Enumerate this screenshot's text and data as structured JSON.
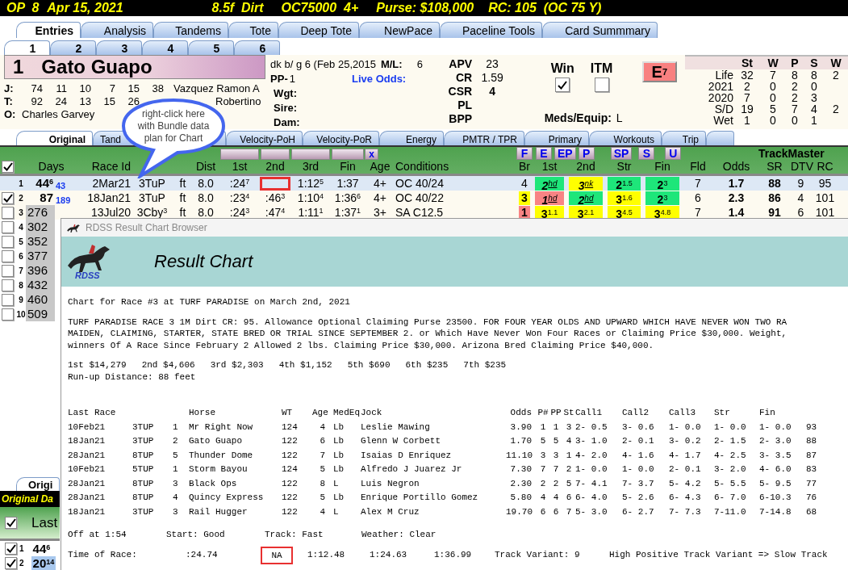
{
  "header": {
    "items": [
      "OP  8",
      "Apr 15, 2021",
      "8.5f  Dirt",
      "OC75000  4+",
      "Purse: $108,000",
      "RC: 105  (OC 75 Y)"
    ]
  },
  "main_tabs": [
    {
      "label": "Entries",
      "selected": true
    },
    {
      "label": "Analysis",
      "selected": false
    },
    {
      "label": "Tandems",
      "selected": false
    },
    {
      "label": "Tote",
      "selected": false
    },
    {
      "label": "Deep Tote",
      "selected": false
    },
    {
      "label": "NewPace",
      "selected": false
    },
    {
      "label": "Paceline Tools",
      "selected": false
    },
    {
      "label": "Card Summmary",
      "selected": false
    }
  ],
  "horse_tabs": [
    {
      "label": "1",
      "selected": true
    },
    {
      "label": "2",
      "selected": false
    },
    {
      "label": "3",
      "selected": false
    },
    {
      "label": "4",
      "selected": false
    },
    {
      "label": "5",
      "selected": false
    },
    {
      "label": "6",
      "selected": false
    }
  ],
  "horse": {
    "number": "1",
    "name": "Gato Guapo",
    "people": [
      {
        "label": "J:",
        "stats": [
          "74",
          "11",
          "10",
          "7",
          "15",
          "38"
        ],
        "name": "Vazquez Ramon A"
      },
      {
        "label": "T:",
        "stats": [
          "92",
          "24",
          "13",
          "15",
          "26"
        ],
        "name": "Robertino"
      },
      {
        "label": "O:",
        "name": "Charles Garvey"
      }
    ],
    "description": "dk b/ g 6 (Feb 25,2015",
    "ml_label": "M/L:",
    "ml": "6",
    "pp_label": "PP-",
    "pp": "1",
    "live_odds": "Live Odds:",
    "fields": [
      "Wgt:",
      "Sire:",
      "Dam:"
    ],
    "ratings": [
      {
        "label": "APV",
        "value": "23",
        "bold": false
      },
      {
        "label": "CR",
        "value": "1.59",
        "bold": false
      },
      {
        "label": "CSR",
        "value": "4",
        "bold": true
      },
      {
        "label": "PL"
      },
      {
        "label": "BPP"
      }
    ],
    "bets": [
      {
        "label": "Win",
        "checked": true
      },
      {
        "label": "ITM",
        "checked": false
      }
    ],
    "meds_label": "Meds/Equip:",
    "meds": "L",
    "badge": {
      "letter": "E",
      "sup": "7"
    },
    "record": {
      "columns": [
        "St",
        "W",
        "P",
        "S",
        "W"
      ],
      "rows": [
        {
          "label": "Life",
          "values": [
            "32",
            "7",
            "8",
            "8",
            "2"
          ]
        },
        {
          "label": "2021",
          "values": [
            "2",
            "0",
            "2",
            "0"
          ]
        },
        {
          "label": "2020",
          "values": [
            "7",
            "0",
            "2",
            "3"
          ]
        },
        {
          "label": "S/D",
          "values": [
            "19",
            "5",
            "7",
            "4",
            "2"
          ]
        },
        {
          "label": "Wet",
          "values": [
            "1",
            "0",
            "0",
            "1"
          ]
        }
      ]
    }
  },
  "sub_tabs": [
    {
      "label": "Original",
      "selected": true
    },
    {
      "label": "Tand",
      "selected": false
    },
    {
      "label": "Velocity-PoH",
      "selected": false
    },
    {
      "label": "Velocity-PoR",
      "selected": false
    },
    {
      "label": "Energy",
      "selected": false
    },
    {
      "label": "PMTR / TPR",
      "selected": false
    },
    {
      "label": "Primary",
      "selected": false
    },
    {
      "label": "Workouts",
      "selected": false
    },
    {
      "label": "Trip",
      "selected": false
    }
  ],
  "callout": {
    "text": "right-click here\nwith Bundle data\nplan for Chart"
  },
  "grid": {
    "header_checked": true,
    "close_button": "x",
    "pace_buttons": [
      "F",
      "E",
      "EP",
      "P",
      "SP",
      "S",
      "U"
    ],
    "group_label": "TrackMaster",
    "columns": [
      "Days",
      "Race Id",
      "Dist",
      "1st",
      "2nd",
      "3rd",
      "Fin",
      "Age",
      "Conditions",
      "Br",
      "1st",
      "2nd",
      "Str",
      "Fin",
      "Fld",
      "Odds",
      "SR",
      "DTV",
      "RC"
    ],
    "rows": [
      {
        "num": "1",
        "selected": true,
        "shaded": false,
        "days": "44",
        "days_sup": "6",
        "days_link": "43",
        "date": "2Mar21",
        "track": "3TuP",
        "surface": "ft",
        "dist": "8.0",
        "calls": [
          {
            "text": ":24",
            "sup": "7"
          },
          {
            "highlighted": true
          },
          {
            "text": "1:12",
            "sup": "5"
          },
          {
            "text": "1:37"
          }
        ],
        "age": "4+",
        "conditions": "OC 40/24",
        "pace": [
          {
            "text": "4"
          },
          {
            "text": "2",
            "sup": "hd",
            "color": "#1ee67a",
            "italic": true
          },
          {
            "text": "3",
            "sup": "nk",
            "color": "#ffff00",
            "italic": true
          },
          {
            "text": "2",
            "sup": "1.5",
            "color": "#1ee67a"
          },
          {
            "text": "2",
            "sup": "3",
            "color": "#1ee67a"
          }
        ],
        "fld": "7",
        "odds": "1.7",
        "sr": "88",
        "dtv": "9",
        "rc": "95"
      },
      {
        "num": "2",
        "checked": true,
        "selected": false,
        "shaded": false,
        "days": "87",
        "days_link": "189",
        "date": "18Jan21",
        "track": "3TuP",
        "surface": "ft",
        "dist": "8.0",
        "calls": [
          {
            "text": ":23",
            "sup": "4"
          },
          {
            "text": ":46",
            "sup": "3"
          },
          {
            "text": "1:10",
            "sup": "4"
          },
          {
            "text": "1:36",
            "sup": "6"
          }
        ],
        "age": "4+",
        "conditions": "OC 40/22",
        "pace": [
          {
            "text": "3",
            "color": "#ffff00"
          },
          {
            "text": "1",
            "sup": "hd",
            "color": "#f88484",
            "italic": true
          },
          {
            "text": "2",
            "sup": "hd",
            "color": "#1ee67a",
            "italic": true
          },
          {
            "text": "3",
            "sup": "1.6",
            "color": "#ffff00"
          },
          {
            "text": "2",
            "sup": "3",
            "color": "#1ee67a"
          }
        ],
        "fld": "6",
        "odds": "2.3",
        "sr": "86",
        "dtv": "4",
        "rc": "101"
      },
      {
        "num": "3",
        "checked": false,
        "selected": false,
        "shaded": true,
        "days": "276",
        "date": "13Jul20",
        "track": "3Cby",
        "track_sup": "3",
        "surface": "ft",
        "dist": "8.0",
        "calls": [
          {
            "text": ":24",
            "sup": "3"
          },
          {
            "text": ":47",
            "sup": "4"
          },
          {
            "text": "1:11",
            "sup": "1"
          },
          {
            "text": "1:37",
            "sup": "1"
          }
        ],
        "age": "3+",
        "conditions": "SA C12.5",
        "pace": [
          {
            "text": "1",
            "color": "#f88484"
          },
          {
            "text": "3",
            "sup": "1.1",
            "color": "#ffff00"
          },
          {
            "text": "3",
            "sup": "2.1",
            "color": "#ffff00"
          },
          {
            "text": "3",
            "sup": "4.5",
            "color": "#ffff00"
          },
          {
            "text": "3",
            "sup": "4.8",
            "color": "#ffff00"
          }
        ],
        "fld": "7",
        "odds": "1.4",
        "sr": "91",
        "dtv": "6",
        "rc": "101"
      },
      {
        "num": "4",
        "checked": false,
        "selected": false,
        "shaded": true,
        "days": "302"
      },
      {
        "num": "5",
        "checked": false,
        "selected": false,
        "shaded": true,
        "days": "352"
      },
      {
        "num": "6",
        "checked": false,
        "selected": false,
        "shaded": true,
        "days": "377"
      },
      {
        "num": "7",
        "checked": false,
        "selected": false,
        "shaded": true,
        "days": "396"
      },
      {
        "num": "8",
        "checked": false,
        "selected": false,
        "shaded": true,
        "days": "432"
      },
      {
        "num": "9",
        "checked": false,
        "selected": false,
        "shaded": true,
        "days": "460"
      },
      {
        "num": "10",
        "checked": false,
        "selected": false,
        "shaded": true,
        "days": "509"
      }
    ]
  },
  "lower_panel": {
    "tab": "Origi",
    "title": "Original Da",
    "header_checked": true,
    "header": "Last",
    "rows": [
      {
        "num": "1",
        "checked": true,
        "selected": false,
        "value": "44",
        "sup": "6"
      },
      {
        "num": "2",
        "checked": true,
        "selected": true,
        "value": "20",
        "sup": "14"
      }
    ]
  },
  "chart_window": {
    "title": "RDSS Result Chart Browser",
    "logo_text": "RDSS",
    "heading": "Result Chart",
    "intro": "Chart for Race #3 at TURF PARADISE on March 2nd, 2021",
    "conditions": [
      "TURF PARADISE RACE 3 1M Dirt CR: 95. Allowance Optional Claiming Purse 23500. FOR FOUR YEAR OLDS AND UPWARD WHICH HAVE NEVER WON TWO RA",
      "MAIDEN, CLAIMING, STARTER, STATE BRED OR TRIAL SINCE SEPTEMBER 2. or Which Have Never Won Four Races or Claiming Price $30,000. Weight,",
      "winners Of A Race Since February 2 Allowed 2 lbs. Claiming Price $30,000. Arizona Bred Claiming Price $40,000."
    ],
    "purses": [
      "1st $14,279",
      "2nd $4,606",
      "3rd $2,303",
      "4th $1,152",
      "5th $690",
      "6th $235",
      "7th $235"
    ],
    "runup": "Run-up Distance: 88 feet",
    "columns": [
      "Last Race",
      "",
      "",
      "Horse",
      "WT",
      "Age",
      "MedEq",
      "Jock",
      "Odds",
      "P#",
      "PP",
      "St",
      "Call1",
      "Call2",
      "Call3",
      "Str",
      "Fin"
    ],
    "rows": [
      [
        "10Feb21",
        "3TUP",
        "1",
        "Mr Right Now",
        "124",
        "4",
        "Lb",
        "Leslie Mawing",
        "3.90",
        "1",
        "1",
        "3",
        "2- 0.5",
        "3- 0.6",
        "1- 0.0",
        "1- 0.0",
        "1- 0.0",
        "93"
      ],
      [
        "18Jan21",
        "3TUP",
        "2",
        "Gato Guapo",
        "122",
        "6",
        "Lb",
        "Glenn W Corbett",
        "1.70",
        "5",
        "5",
        "4",
        "3- 1.0",
        "2- 0.1",
        "3- 0.2",
        "2- 1.5",
        "2- 3.0",
        "88"
      ],
      [
        "28Jan21",
        "8TUP",
        "5",
        "Thunder Dome",
        "122",
        "7",
        "Lb",
        "Isaias D Enriquez",
        "11.10",
        "3",
        "3",
        "1",
        "4- 2.0",
        "4- 1.6",
        "4- 1.7",
        "4- 2.5",
        "3- 3.5",
        "87"
      ],
      [
        "10Feb21",
        "5TUP",
        "1",
        "Storm Bayou",
        "124",
        "5",
        "Lb",
        "Alfredo J Juarez Jr",
        "7.30",
        "7",
        "7",
        "2",
        "1- 0.0",
        "1- 0.0",
        "2- 0.1",
        "3- 2.0",
        "4- 6.0",
        "83"
      ],
      [
        "28Jan21",
        "8TUP",
        "3",
        "Black Ops",
        "122",
        "8",
        "L",
        "Luis Negron",
        "2.30",
        "2",
        "2",
        "5",
        "7- 4.1",
        "7- 3.7",
        "5- 4.2",
        "5- 5.5",
        "5- 9.5",
        "77"
      ],
      [
        "28Jan21",
        "8TUP",
        "4",
        "Quincy Express",
        "122",
        "5",
        "Lb",
        "Enrique Portillo Gomez",
        "5.80",
        "4",
        "4",
        "6",
        "6- 4.0",
        "5- 2.6",
        "6- 4.3",
        "6- 7.0",
        "6-10.3",
        "76"
      ],
      [
        "18Jan21",
        "3TUP",
        "3",
        "Rail Hugger",
        "122",
        "4",
        "L",
        "Alex M Cruz",
        "19.70",
        "6",
        "6",
        "7",
        "5- 3.0",
        "6- 2.7",
        "7- 7.3",
        "7-11.0",
        "7-14.8",
        "68"
      ]
    ],
    "conditions_line": [
      "Off at 1:54",
      "Start: Good",
      "Track: Fast",
      "Weather: Clear"
    ],
    "times": [
      {
        "text": "Time of Race:"
      },
      {
        "text": ":24.74"
      },
      {
        "text": "NA",
        "highlighted": true
      },
      {
        "text": "1:12.48"
      },
      {
        "text": "1:24.63"
      },
      {
        "text": "1:36.99"
      },
      {
        "text": "Track Variant: 9"
      },
      {
        "text": "High Positive Track Variant => Slow Track"
      }
    ]
  }
}
